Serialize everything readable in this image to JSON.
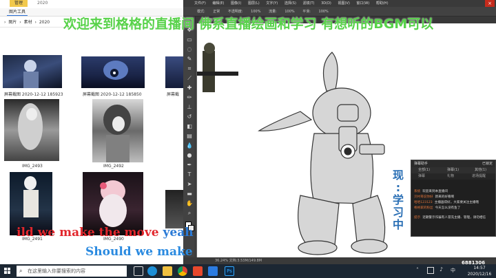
{
  "explorer": {
    "tab_manage": "管理",
    "title_year": "2020",
    "tab_picture_tools": "图片工具",
    "breadcrumb": [
      "图片",
      "素材",
      "2020"
    ],
    "thumbnails": [
      {
        "caption": "屏幕截图 2020-12-12 185923"
      },
      {
        "caption": "屏幕截图 2020-12-12 185850"
      },
      {
        "caption": "屏幕截"
      },
      {
        "caption": "IMG_2493"
      },
      {
        "caption": "IMG_2492"
      },
      {
        "caption": "IMG_2491"
      },
      {
        "caption": "IMG_2490"
      }
    ]
  },
  "photoshop": {
    "menu": [
      "文件(F)",
      "编辑(E)",
      "图像(I)",
      "图层(L)",
      "文字(Y)",
      "选择(S)",
      "滤镜(T)",
      "3D(D)",
      "视图(V)",
      "窗口(W)",
      "帮助(H)"
    ],
    "options": [
      "模式:",
      "正常",
      "不透明度:",
      "100%",
      "流量:",
      "100%",
      "平滑:",
      "100%"
    ],
    "doc_tab": "格格画.psd",
    "status": "36.24%   文档:3.53M/149.8M",
    "tools": [
      "move-icon",
      "marquee-icon",
      "lasso-icon",
      "quick-select-icon",
      "crop-icon",
      "eyedropper-icon",
      "spot-heal-icon",
      "brush-icon",
      "stamp-icon",
      "history-brush-icon",
      "eraser-icon",
      "gradient-icon",
      "blur-icon",
      "dodge-icon",
      "pen-icon",
      "type-icon",
      "path-select-icon",
      "shape-icon",
      "hand-icon",
      "zoom-icon"
    ]
  },
  "chat": {
    "header": "弹幕助手",
    "header_right": "已锁定",
    "tabs": [
      "全部(1)",
      "弹幕(1)",
      "其他(1)"
    ],
    "subtabs": [
      "弹幕",
      "礼物",
      "进场提醒"
    ],
    "messages": [
      {
        "name": "系统",
        "text": "欢迎来到本直播间"
      },
      {
        "name": "贝村哥说你好",
        "text": "新来的好看啊"
      },
      {
        "name": "哈哈123123",
        "text": "主播画得好，大家要关注主播哦"
      },
      {
        "name": "格格家的粉丝",
        "text": "今天怎么没有鱼了"
      },
      {
        "name": "提示",
        "text": "近期警示诈骗有人冒充主播、管理，请勿相信"
      }
    ]
  },
  "overlays": {
    "welcome": "欢迎来到格格的直播间   佛系直播绘画和学习     有想听的BGM可以",
    "now_studying": [
      "现",
      ":",
      "学",
      "习",
      "中"
    ],
    "lyric_line1_red": "ild we make the move ",
    "lyric_line1_blue": "yeah",
    "lyric_line2": "Should we make"
  },
  "taskbar": {
    "search_placeholder": "在这里输入你要搜索的内容",
    "clock_time": "14:57",
    "clock_date": "2020/12/16",
    "stream_id": "6881306"
  }
}
